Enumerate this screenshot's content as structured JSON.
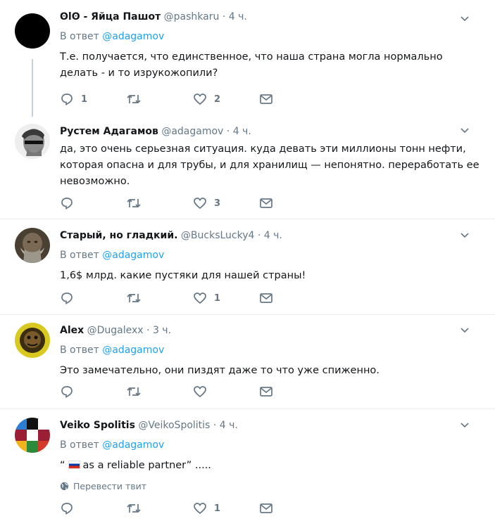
{
  "tweets": [
    {
      "name": "ʘlʘ - Яйца Пашот",
      "handle": "@pashkaru",
      "time": "4 ч.",
      "reply_prefix": "В ответ",
      "reply_to": "@adagamov",
      "text": "Т.е. получается, что единственное, что наша страна могла нормально делать - и то изрукожопили?",
      "reply_count": "1",
      "retweet_count": "",
      "like_count": "2"
    },
    {
      "name": "Рустем Адагамов",
      "handle": "@adagamov",
      "time": "4 ч.",
      "text": "да, это очень серьезная ситуация. куда девать эти миллионы тонн нефти, которая опасна и для трубы, и для хранилищ — непонятно. переработать ее невозможно.",
      "reply_count": "",
      "retweet_count": "",
      "like_count": "3"
    },
    {
      "name": "Старый, но гладкий.",
      "handle": "@BucksLucky4",
      "time": "4 ч.",
      "reply_prefix": "В ответ",
      "reply_to": "@adagamov",
      "text": "1,6$ млрд. какие пустяки для нашей страны!",
      "reply_count": "",
      "retweet_count": "",
      "like_count": "1"
    },
    {
      "name": "Alex",
      "handle": "@Dugalexx",
      "time": "3 ч.",
      "reply_prefix": "В ответ",
      "reply_to": "@adagamov",
      "text": "Это замечательно, они пиздят даже то что уже спиженно.",
      "reply_count": "",
      "retweet_count": "",
      "like_count": ""
    },
    {
      "name": "Veiko Spolitis",
      "handle": "@VeikoSpolitis",
      "time": "4 ч.",
      "reply_prefix": "В ответ",
      "reply_to": "@adagamov",
      "text_open_quote": "“",
      "text_rest": "as a reliable partner” .....",
      "translate_label": "Перевести твит",
      "reply_count": "",
      "retweet_count": "",
      "like_count": "1"
    }
  ],
  "separator_dot": "·",
  "colors": {
    "link": "#1da1f2",
    "muted": "#657786",
    "text": "#14171a",
    "border": "#e6ecf0"
  }
}
